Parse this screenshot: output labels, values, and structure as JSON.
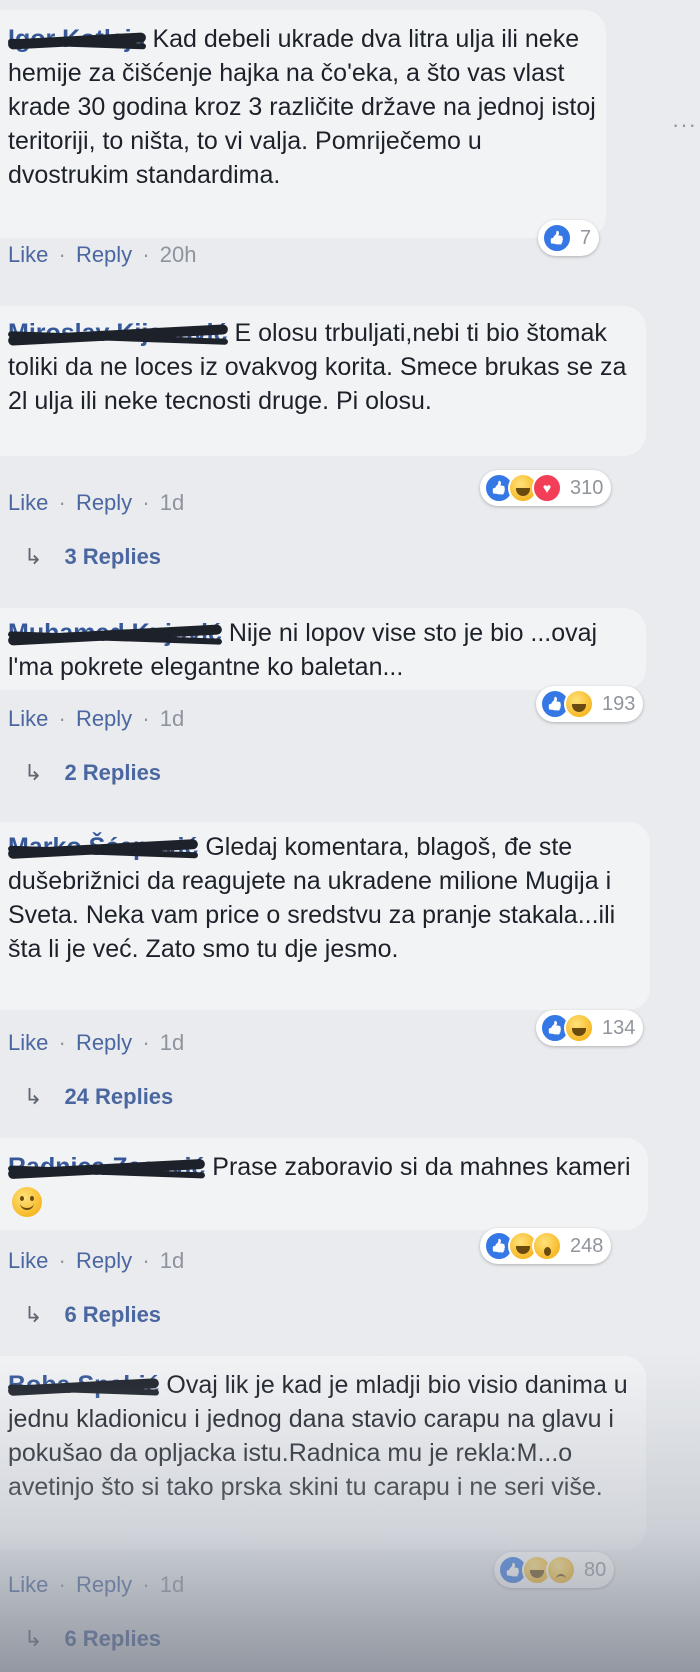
{
  "ui": {
    "like_label": "Like",
    "reply_label": "Reply",
    "separator": "·",
    "reply_arrow": "↳"
  },
  "colors": {
    "link_blue": "#4b67a1",
    "author_blue": "#365899",
    "bubble_bg": "#f2f3f5",
    "like_blue": "#3578e5",
    "love_red": "#f33e58"
  },
  "comments": [
    {
      "author": "Igor Kotlaja",
      "text": "Kad debeli ukrade dva litra ulja ili neke hemije za čišćenje hajka na čo'eka, a što vas vlast krade 30 godina kroz 3 različite države na jednoj istoj teritoriji, to ništa, to vi valja. Pomriječemo u dvostrukim standardima.",
      "time": "20h",
      "reactions": [
        "like"
      ],
      "reaction_count": "7",
      "replies": null
    },
    {
      "author": "Miroslav Kijanović",
      "text": "E olosu trbuljati,nebi ti bio štomak toliki da ne loces iz ovakvog korita. Smece brukas se za 2l ulja ili neke tecnosti druge. Pi olosu.",
      "time": "1d",
      "reactions": [
        "like",
        "haha",
        "love"
      ],
      "reaction_count": "310",
      "replies": "3 Replies"
    },
    {
      "author": "Muhamed Kujović",
      "text": "Nije ni lopov vise sto je bio ...ovaj l'ma pokrete elegantne ko baletan...",
      "time": "1d",
      "reactions": [
        "like",
        "haha"
      ],
      "reaction_count": "193",
      "replies": "2 Replies"
    },
    {
      "author": "Marko Šćepović",
      "text": "Gledaj komentara, blagoš, đe ste dušebrižnici da reagujete na ukradene milione Mugija i Sveta. Neka vam price o sredstvu za pranje stakala...ili šta li je već. Zato smo tu dje jesmo.",
      "time": "1d",
      "reactions": [
        "like",
        "haha"
      ],
      "reaction_count": "134",
      "replies": "24 Replies"
    },
    {
      "author": "Radnica Zecović",
      "text": "Prase zaboravio si da mahnes kameri",
      "emoji": true,
      "time": "1d",
      "reactions": [
        "like",
        "haha",
        "wow"
      ],
      "reaction_count": "248",
      "replies": "6 Replies"
    },
    {
      "author": "Boba Spahić",
      "text": "Ovaj lik je kad je mladji bio visio danima u jednu kladionicu i jednog dana stavio carapu na glavu i pokušao da opljacka istu.Radnica mu je rekla:M...o avetinjo što si tako prska skini tu carapu i ne seri više.",
      "time": "1d",
      "reactions": [
        "like",
        "haha",
        "sad"
      ],
      "reaction_count": "80",
      "replies": "6 Replies"
    }
  ]
}
